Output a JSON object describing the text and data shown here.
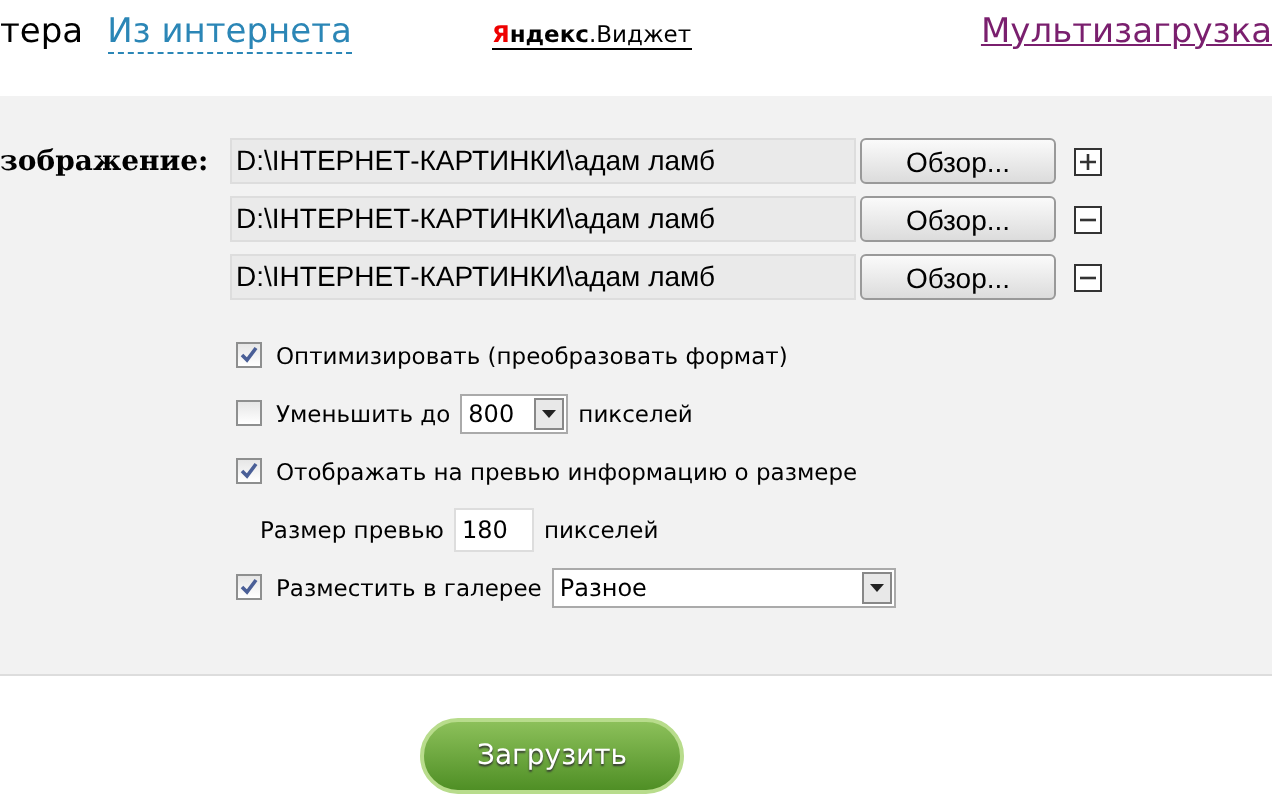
{
  "tabs": [
    {
      "label": "тера",
      "kind": "plain"
    },
    {
      "label": "Из интернета",
      "kind": "link"
    }
  ],
  "widget_logo": {
    "brand": "Яндекс",
    "suffix": ".Виджет"
  },
  "multi_upload_link": "Мультизагрузка",
  "image_label": "зображение:",
  "files": [
    {
      "value": "D:\\IНТЕРНЕТ-КАРТИНКИ\\адам ламб",
      "browse": "Обзор...",
      "kind": "add"
    },
    {
      "value": "D:\\IНТЕРНЕТ-КАРТИНКИ\\адам ламб",
      "browse": "Обзор...",
      "kind": "remove"
    },
    {
      "value": "D:\\IНТЕРНЕТ-КАРТИНКИ\\адам ламб",
      "browse": "Обзор...",
      "kind": "remove"
    }
  ],
  "options": [
    {
      "kind": "check",
      "label": "Оптимизировать (преобразовать формат)",
      "checked": true
    },
    {
      "kind": "check_select",
      "label": "Уменьшить до",
      "checked": false,
      "value": "800",
      "unit": "пикселей"
    },
    {
      "kind": "check",
      "label": "Отображать на превью информацию о размере",
      "checked": true
    },
    {
      "kind": "size",
      "label": "Размер превью",
      "value": "180",
      "unit": "пикселей"
    },
    {
      "kind": "gallery",
      "label": "Разместить в галерее",
      "checked": true,
      "value": "Разное"
    }
  ],
  "submit": "Загрузить"
}
